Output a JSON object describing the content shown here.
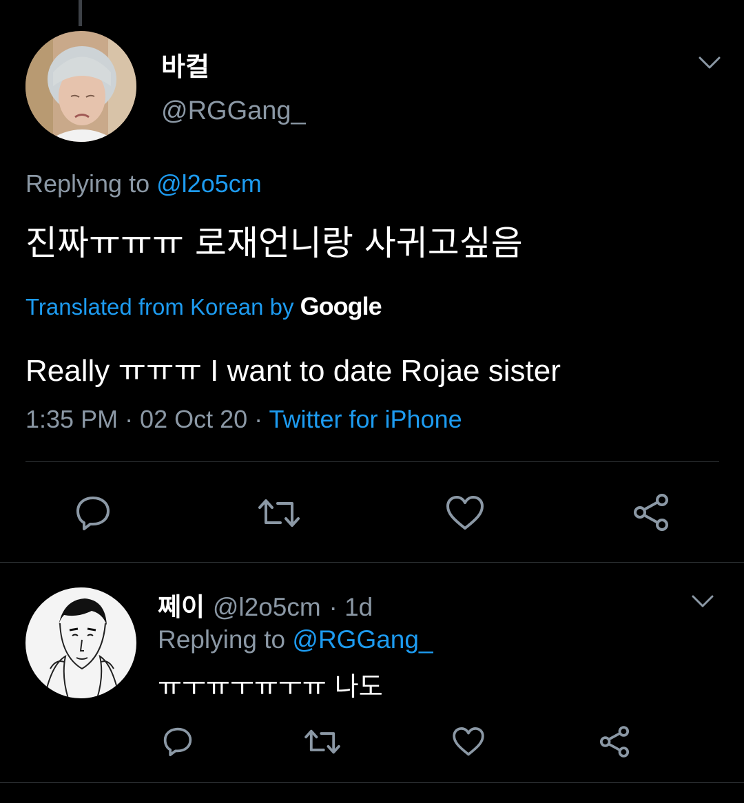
{
  "main_tweet": {
    "display_name": "바컬",
    "handle": "@RGGang_",
    "replying_prefix": "Replying to",
    "replying_handle": "@l2o5cm",
    "text": "진짜ㅠㅠㅠ 로재언니랑 사귀고싶음",
    "translated_label": "Translated from Korean by",
    "translation_provider": "Google",
    "translation": "Really ㅠㅠㅠ I want to date Rojae sister",
    "timestamp": "1:35 PM · 02 Oct 20 ·",
    "source": "Twitter for iPhone"
  },
  "reply_tweet": {
    "display_name": "쩨이",
    "handle": "@l2o5cm",
    "time_ago": "· 1d",
    "replying_prefix": "Replying to",
    "replying_handle": "@RGGang_",
    "text": "ㅠㅜㅠㅜㅠㅜㅠ 나도"
  },
  "icons": {
    "reply": "speech-bubble-icon",
    "retweet": "retweet-arrows-icon",
    "like": "heart-icon",
    "share": "share-nodes-icon",
    "menu": "chevron-down-icon"
  },
  "colors": {
    "background": "#000000",
    "text_primary": "#ffffff",
    "text_secondary": "#8b98a5",
    "link": "#1d9bf0",
    "divider": "#2f3336"
  }
}
